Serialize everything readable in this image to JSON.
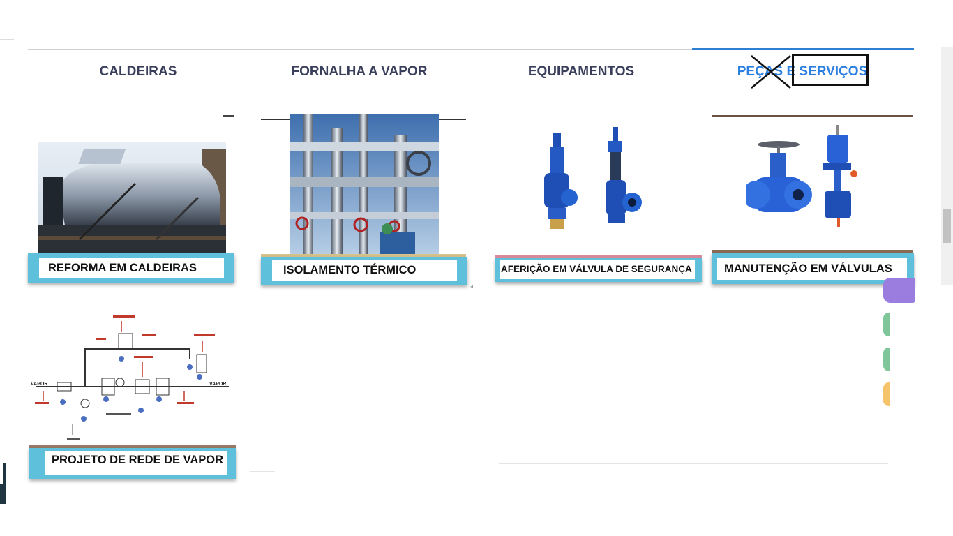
{
  "tabs": [
    {
      "label": "CALDEIRAS",
      "active": false
    },
    {
      "label": "FORNALHA A VAPOR",
      "active": false
    },
    {
      "label": "EQUIPAMENTOS",
      "active": false
    },
    {
      "label": "PEÇAS E SERVIÇOS",
      "active": true
    }
  ],
  "cards": [
    {
      "label": "REFORMA EM CALDEIRAS"
    },
    {
      "label": "ISOLAMENTO TÉRMICO"
    },
    {
      "label": "AFERIÇÃO EM VÁLVULA DE SEGURANÇA"
    },
    {
      "label": "MANUTENÇÃO EM VÁLVULAS"
    },
    {
      "label": "PROJETO DE REDE DE VAPOR"
    }
  ],
  "diagram_labels": {
    "vapor_left": "VAPOR",
    "vapor_right": "VAPOR"
  },
  "colors": {
    "tab_text": "#3a3f5c",
    "tab_active": "#2a7fe0",
    "label_band": "#5fc0db",
    "valve_blue": "#1f4fb5"
  },
  "side_pills": [
    "#9b7de0",
    "#7fc79a",
    "#7fc79a",
    "#f5c46a"
  ]
}
